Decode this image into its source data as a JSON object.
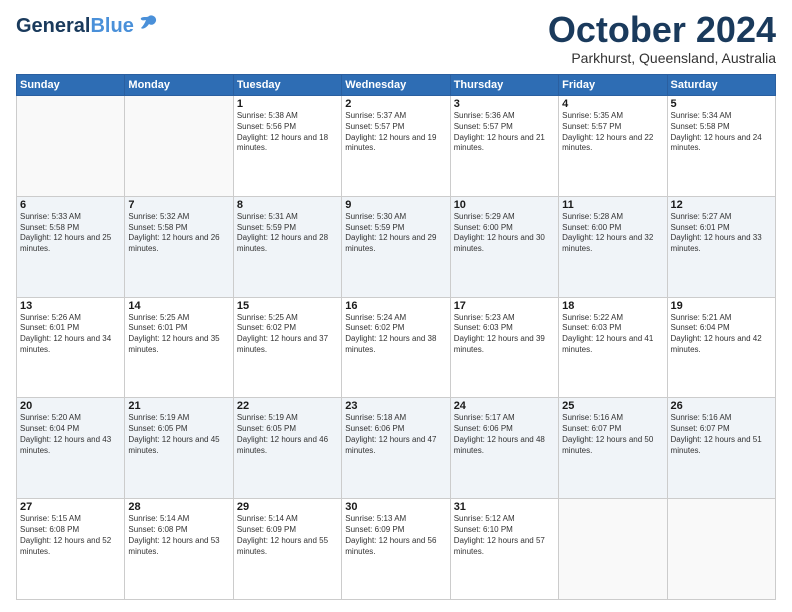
{
  "header": {
    "logo_general": "General",
    "logo_blue": "Blue",
    "month": "October 2024",
    "location": "Parkhurst, Queensland, Australia"
  },
  "weekdays": [
    "Sunday",
    "Monday",
    "Tuesday",
    "Wednesday",
    "Thursday",
    "Friday",
    "Saturday"
  ],
  "weeks": [
    [
      {
        "day": "",
        "sunrise": "",
        "sunset": "",
        "daylight": ""
      },
      {
        "day": "",
        "sunrise": "",
        "sunset": "",
        "daylight": ""
      },
      {
        "day": "1",
        "sunrise": "Sunrise: 5:38 AM",
        "sunset": "Sunset: 5:56 PM",
        "daylight": "Daylight: 12 hours and 18 minutes."
      },
      {
        "day": "2",
        "sunrise": "Sunrise: 5:37 AM",
        "sunset": "Sunset: 5:57 PM",
        "daylight": "Daylight: 12 hours and 19 minutes."
      },
      {
        "day": "3",
        "sunrise": "Sunrise: 5:36 AM",
        "sunset": "Sunset: 5:57 PM",
        "daylight": "Daylight: 12 hours and 21 minutes."
      },
      {
        "day": "4",
        "sunrise": "Sunrise: 5:35 AM",
        "sunset": "Sunset: 5:57 PM",
        "daylight": "Daylight: 12 hours and 22 minutes."
      },
      {
        "day": "5",
        "sunrise": "Sunrise: 5:34 AM",
        "sunset": "Sunset: 5:58 PM",
        "daylight": "Daylight: 12 hours and 24 minutes."
      }
    ],
    [
      {
        "day": "6",
        "sunrise": "Sunrise: 5:33 AM",
        "sunset": "Sunset: 5:58 PM",
        "daylight": "Daylight: 12 hours and 25 minutes."
      },
      {
        "day": "7",
        "sunrise": "Sunrise: 5:32 AM",
        "sunset": "Sunset: 5:58 PM",
        "daylight": "Daylight: 12 hours and 26 minutes."
      },
      {
        "day": "8",
        "sunrise": "Sunrise: 5:31 AM",
        "sunset": "Sunset: 5:59 PM",
        "daylight": "Daylight: 12 hours and 28 minutes."
      },
      {
        "day": "9",
        "sunrise": "Sunrise: 5:30 AM",
        "sunset": "Sunset: 5:59 PM",
        "daylight": "Daylight: 12 hours and 29 minutes."
      },
      {
        "day": "10",
        "sunrise": "Sunrise: 5:29 AM",
        "sunset": "Sunset: 6:00 PM",
        "daylight": "Daylight: 12 hours and 30 minutes."
      },
      {
        "day": "11",
        "sunrise": "Sunrise: 5:28 AM",
        "sunset": "Sunset: 6:00 PM",
        "daylight": "Daylight: 12 hours and 32 minutes."
      },
      {
        "day": "12",
        "sunrise": "Sunrise: 5:27 AM",
        "sunset": "Sunset: 6:01 PM",
        "daylight": "Daylight: 12 hours and 33 minutes."
      }
    ],
    [
      {
        "day": "13",
        "sunrise": "Sunrise: 5:26 AM",
        "sunset": "Sunset: 6:01 PM",
        "daylight": "Daylight: 12 hours and 34 minutes."
      },
      {
        "day": "14",
        "sunrise": "Sunrise: 5:25 AM",
        "sunset": "Sunset: 6:01 PM",
        "daylight": "Daylight: 12 hours and 35 minutes."
      },
      {
        "day": "15",
        "sunrise": "Sunrise: 5:25 AM",
        "sunset": "Sunset: 6:02 PM",
        "daylight": "Daylight: 12 hours and 37 minutes."
      },
      {
        "day": "16",
        "sunrise": "Sunrise: 5:24 AM",
        "sunset": "Sunset: 6:02 PM",
        "daylight": "Daylight: 12 hours and 38 minutes."
      },
      {
        "day": "17",
        "sunrise": "Sunrise: 5:23 AM",
        "sunset": "Sunset: 6:03 PM",
        "daylight": "Daylight: 12 hours and 39 minutes."
      },
      {
        "day": "18",
        "sunrise": "Sunrise: 5:22 AM",
        "sunset": "Sunset: 6:03 PM",
        "daylight": "Daylight: 12 hours and 41 minutes."
      },
      {
        "day": "19",
        "sunrise": "Sunrise: 5:21 AM",
        "sunset": "Sunset: 6:04 PM",
        "daylight": "Daylight: 12 hours and 42 minutes."
      }
    ],
    [
      {
        "day": "20",
        "sunrise": "Sunrise: 5:20 AM",
        "sunset": "Sunset: 6:04 PM",
        "daylight": "Daylight: 12 hours and 43 minutes."
      },
      {
        "day": "21",
        "sunrise": "Sunrise: 5:19 AM",
        "sunset": "Sunset: 6:05 PM",
        "daylight": "Daylight: 12 hours and 45 minutes."
      },
      {
        "day": "22",
        "sunrise": "Sunrise: 5:19 AM",
        "sunset": "Sunset: 6:05 PM",
        "daylight": "Daylight: 12 hours and 46 minutes."
      },
      {
        "day": "23",
        "sunrise": "Sunrise: 5:18 AM",
        "sunset": "Sunset: 6:06 PM",
        "daylight": "Daylight: 12 hours and 47 minutes."
      },
      {
        "day": "24",
        "sunrise": "Sunrise: 5:17 AM",
        "sunset": "Sunset: 6:06 PM",
        "daylight": "Daylight: 12 hours and 48 minutes."
      },
      {
        "day": "25",
        "sunrise": "Sunrise: 5:16 AM",
        "sunset": "Sunset: 6:07 PM",
        "daylight": "Daylight: 12 hours and 50 minutes."
      },
      {
        "day": "26",
        "sunrise": "Sunrise: 5:16 AM",
        "sunset": "Sunset: 6:07 PM",
        "daylight": "Daylight: 12 hours and 51 minutes."
      }
    ],
    [
      {
        "day": "27",
        "sunrise": "Sunrise: 5:15 AM",
        "sunset": "Sunset: 6:08 PM",
        "daylight": "Daylight: 12 hours and 52 minutes."
      },
      {
        "day": "28",
        "sunrise": "Sunrise: 5:14 AM",
        "sunset": "Sunset: 6:08 PM",
        "daylight": "Daylight: 12 hours and 53 minutes."
      },
      {
        "day": "29",
        "sunrise": "Sunrise: 5:14 AM",
        "sunset": "Sunset: 6:09 PM",
        "daylight": "Daylight: 12 hours and 55 minutes."
      },
      {
        "day": "30",
        "sunrise": "Sunrise: 5:13 AM",
        "sunset": "Sunset: 6:09 PM",
        "daylight": "Daylight: 12 hours and 56 minutes."
      },
      {
        "day": "31",
        "sunrise": "Sunrise: 5:12 AM",
        "sunset": "Sunset: 6:10 PM",
        "daylight": "Daylight: 12 hours and 57 minutes."
      },
      {
        "day": "",
        "sunrise": "",
        "sunset": "",
        "daylight": ""
      },
      {
        "day": "",
        "sunrise": "",
        "sunset": "",
        "daylight": ""
      }
    ]
  ]
}
